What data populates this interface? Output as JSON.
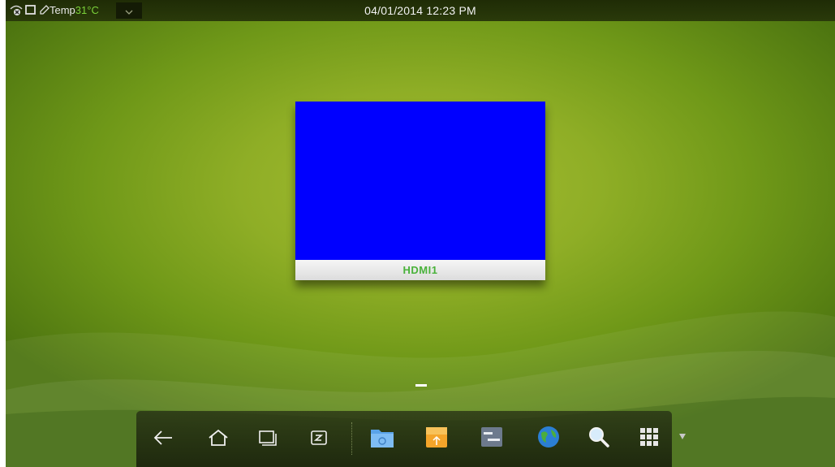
{
  "status_bar": {
    "temp_label": "Temp",
    "temp_value": "31°C",
    "datetime": "04/01/2014 12:23  PM",
    "icons": [
      "network-icon",
      "screen-share-icon",
      "edit-icon",
      "chevron-down-icon"
    ]
  },
  "source": {
    "label": "HDMI1",
    "preview_color": "#0000ff"
  },
  "dock": {
    "buttons": [
      "back-icon",
      "home-icon",
      "recent-apps-icon",
      "input-mode-icon",
      "file-manager-icon",
      "usb-storage-icon",
      "settings-icon",
      "browser-icon",
      "search-icon",
      "apps-grid-icon"
    ]
  },
  "colors": {
    "accent_green": "#49b23a",
    "temp_green": "#7bd13a",
    "background": "#8fae26"
  }
}
